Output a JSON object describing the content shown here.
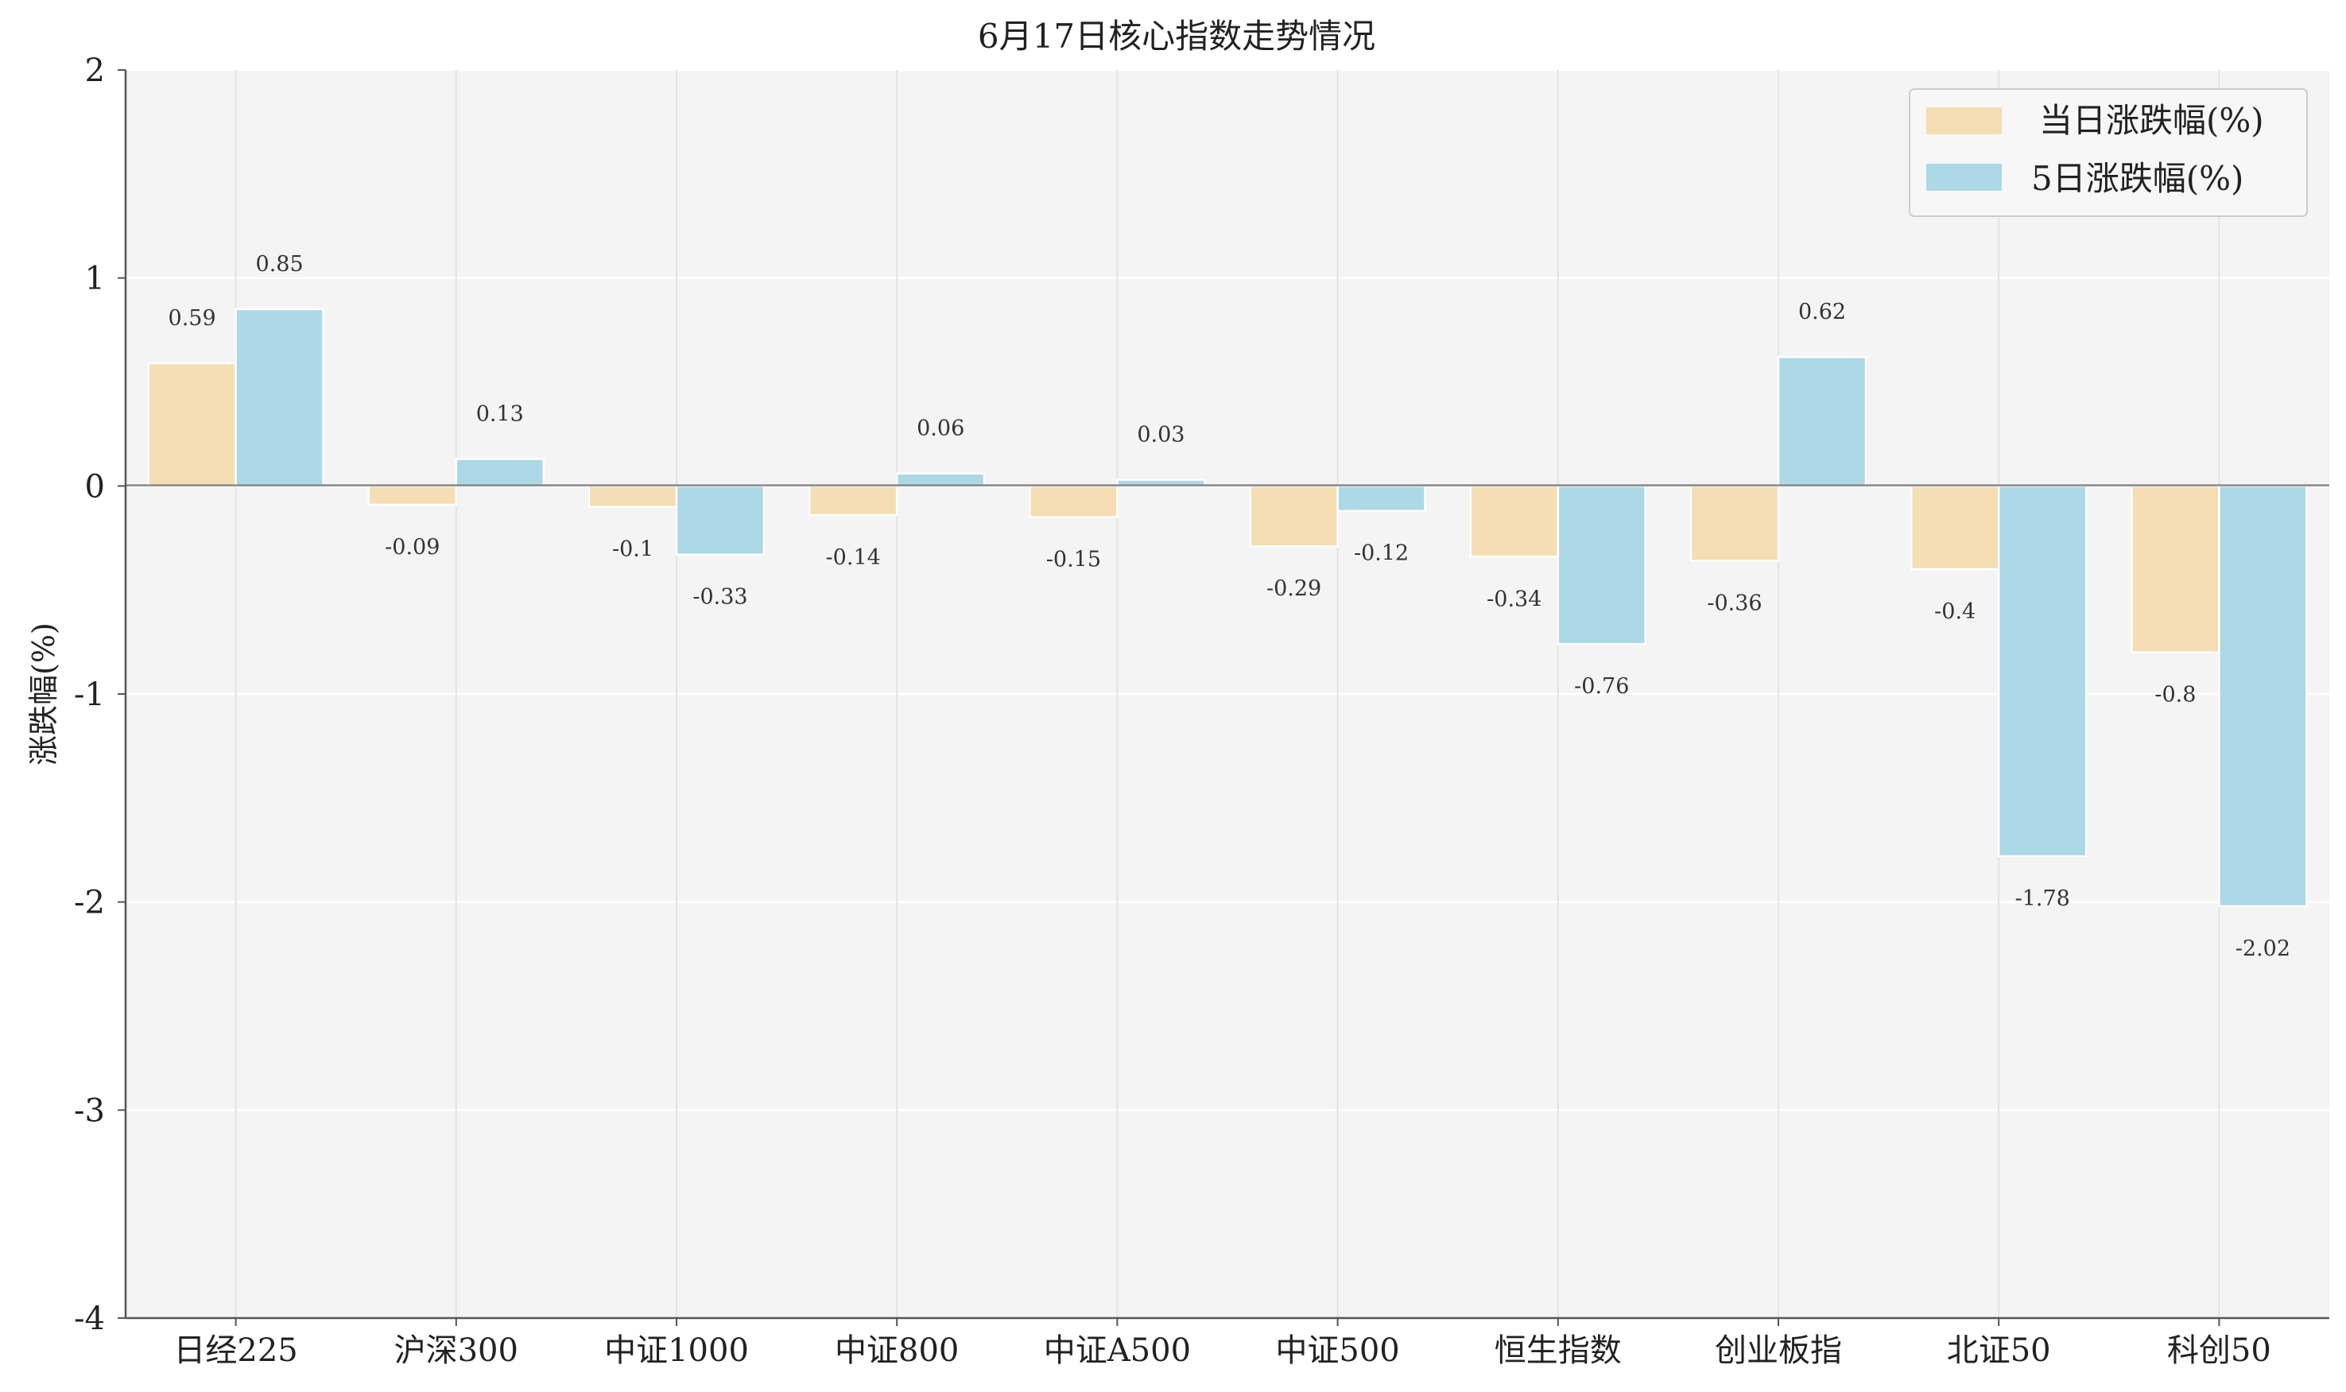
{
  "chart_data": {
    "type": "bar",
    "title": "6月17日核心指数走势情况",
    "xlabel": "",
    "ylabel": "涨跌幅(%)",
    "ylim": [
      -4,
      2
    ],
    "yticks": [
      "2",
      "1",
      "0",
      "-1",
      "-2",
      "-3",
      "-4"
    ],
    "categories": [
      "日经225",
      "沪深300",
      "中证1000",
      "中证800",
      "中证A500",
      "中证500",
      "恒生指数",
      "创业板指",
      "北证50",
      "科创50"
    ],
    "series": [
      {
        "name": "当日涨跌幅(%)",
        "color": "#f5deb3",
        "values": [
          0.59,
          -0.09,
          -0.1,
          -0.14,
          -0.15,
          -0.29,
          -0.34,
          -0.36,
          -0.4,
          -0.8
        ],
        "labels": [
          "0.59",
          "-0.09",
          "-0.1",
          "-0.14",
          "-0.15",
          "-0.29",
          "-0.34",
          "-0.36",
          "-0.4",
          "-0.8"
        ]
      },
      {
        "name": "5日涨跌幅(%)",
        "color": "#add8e6",
        "values": [
          0.85,
          0.13,
          -0.33,
          0.06,
          0.03,
          -0.12,
          -0.76,
          0.62,
          -1.78,
          -2.02
        ],
        "labels": [
          "0.85",
          "0.13",
          "-0.33",
          "0.06",
          "0.03",
          "-0.12",
          "-0.76",
          "0.62",
          "-1.78",
          "-2.02"
        ]
      }
    ],
    "grid": true,
    "legend_position": "top-right",
    "background": "#f4f4f4"
  }
}
